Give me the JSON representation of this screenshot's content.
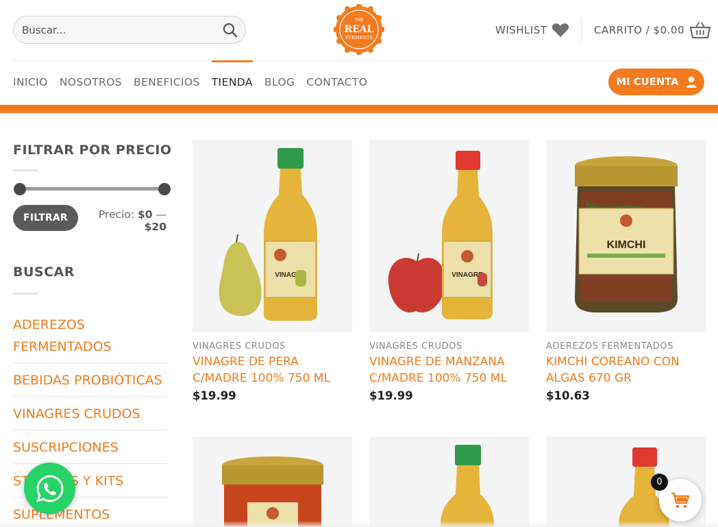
{
  "search": {
    "placeholder": "Buscar..."
  },
  "logo": {
    "line1": "THE",
    "line2": "REAL",
    "line3": "FERMENTS",
    "color": "#f47b20"
  },
  "header": {
    "wishlist_label": "WISHLIST",
    "cart_label": "CARRITO / $0.00"
  },
  "nav": {
    "items": [
      {
        "label": "INICIO"
      },
      {
        "label": "NOSOTROS"
      },
      {
        "label": "BENEFICIOS"
      },
      {
        "label": "TIENDA",
        "active": true
      },
      {
        "label": "BLOG"
      },
      {
        "label": "CONTACTO"
      }
    ],
    "account_label": "MI CUENTA"
  },
  "sidebar": {
    "price_filter": {
      "title": "FILTRAR POR PRECIO",
      "button_label": "FILTRAR",
      "price_prefix": "Precio:",
      "min": "$0",
      "separator": "—",
      "max": "$20"
    },
    "search_title": "BUSCAR",
    "categories": [
      {
        "label": "ADEREZOS FERMENTADOS"
      },
      {
        "label": "BEBIDAS PROBIÓTICAS"
      },
      {
        "label": "VINAGRES CRUDOS"
      },
      {
        "label": "SUSCRIPCIONES"
      },
      {
        "label": "STARTERS Y KITS"
      },
      {
        "label": "SUPLEMENTOS"
      }
    ]
  },
  "products": [
    {
      "category": "VINAGRES CRUDOS",
      "title": "VINAGRE DE PERA C/MADRE 100% 750 ML",
      "price": "$19.99",
      "label": "VINAGRE"
    },
    {
      "category": "VINAGRES CRUDOS",
      "title": "VINAGRE DE MANZANA C/MADRE 100% 750 ML",
      "price": "$19.99",
      "label": "VINAGRE"
    },
    {
      "category": "ADEREZOS FERMENTADOS",
      "title": "KIMCHI COREANO CON ALGAS 670 GR",
      "price": "$10.63",
      "label": "KIMCHI"
    }
  ],
  "floating": {
    "cart_count": "0"
  },
  "colors": {
    "accent": "#f47b20",
    "whatsapp": "#25d366"
  }
}
